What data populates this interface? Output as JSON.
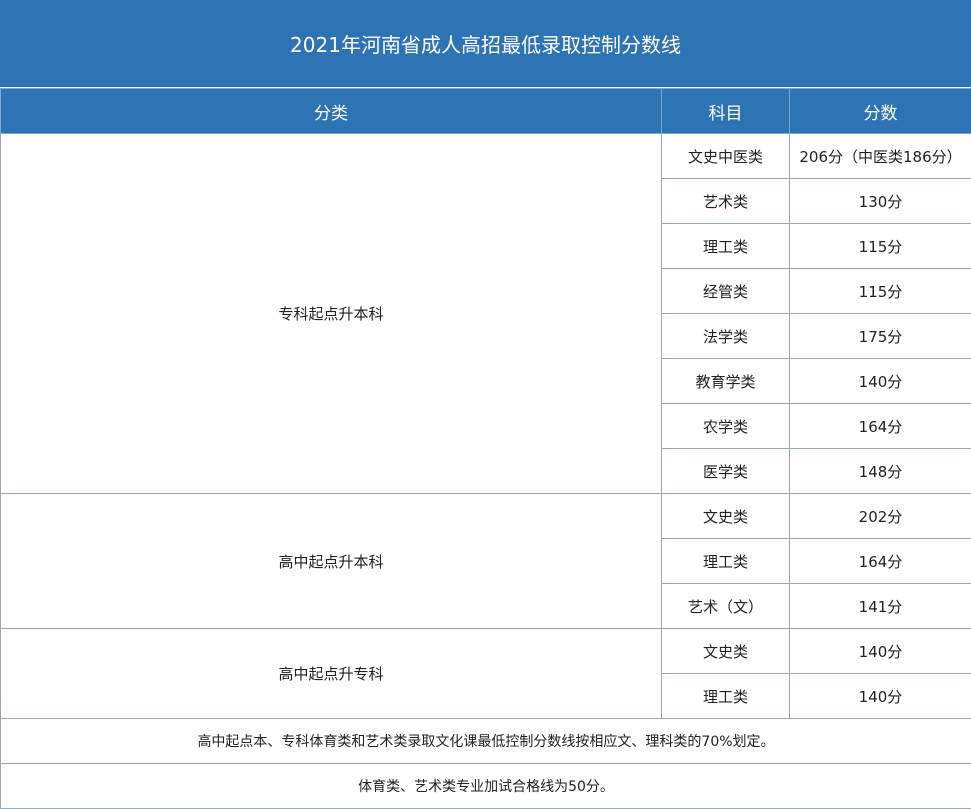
{
  "title": "2021年河南省成人高招最低录取控制分数线",
  "headers": {
    "category": "分类",
    "subject": "科目",
    "score": "分数"
  },
  "groups": [
    {
      "name": "专科起点升本科",
      "rows": [
        {
          "subject": "文史中医类",
          "score": "206分（中医类186分）"
        },
        {
          "subject": "艺术类",
          "score": "130分"
        },
        {
          "subject": "理工类",
          "score": "115分"
        },
        {
          "subject": "经管类",
          "score": "115分"
        },
        {
          "subject": "法学类",
          "score": "175分"
        },
        {
          "subject": "教育学类",
          "score": "140分"
        },
        {
          "subject": "农学类",
          "score": "164分"
        },
        {
          "subject": "医学类",
          "score": "148分"
        }
      ]
    },
    {
      "name": "高中起点升本科",
      "rows": [
        {
          "subject": "文史类",
          "score": "202分"
        },
        {
          "subject": "理工类",
          "score": "164分"
        },
        {
          "subject": "艺术（文）",
          "score": "141分"
        }
      ]
    },
    {
      "name": "高中起点升专科",
      "rows": [
        {
          "subject": "文史类",
          "score": "140分"
        },
        {
          "subject": "理工类",
          "score": "140分"
        }
      ]
    }
  ],
  "notes": [
    "高中起点本、专科体育类和艺术类录取文化课最低控制分数线按相应文、理科类的70%划定。",
    "体育类、艺术类专业加试合格线为50分。"
  ]
}
